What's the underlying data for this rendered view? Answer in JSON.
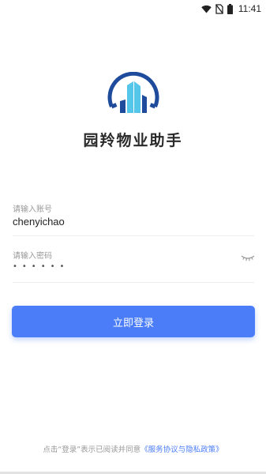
{
  "status_bar": {
    "time": "11:41",
    "icons": [
      "wifi-icon",
      "no-sim-icon",
      "battery-icon"
    ]
  },
  "app": {
    "logo_icon": "building-logo-icon",
    "name": "园羚物业助手",
    "colors": {
      "logo_ring": "#1f4b9c",
      "logo_building": "#53c6ea",
      "accent": "#4a7df7"
    }
  },
  "form": {
    "account": {
      "label": "请输入账号",
      "value": "chenyichao"
    },
    "password": {
      "label": "请输入密码",
      "masked_value": "••••••",
      "toggle_icon": "eye-closed-icon"
    },
    "login_label": "立即登录"
  },
  "agreement": {
    "prefix": "点击“登录”表示已阅读并同意",
    "link": "《服务协议与隐私政策》"
  }
}
